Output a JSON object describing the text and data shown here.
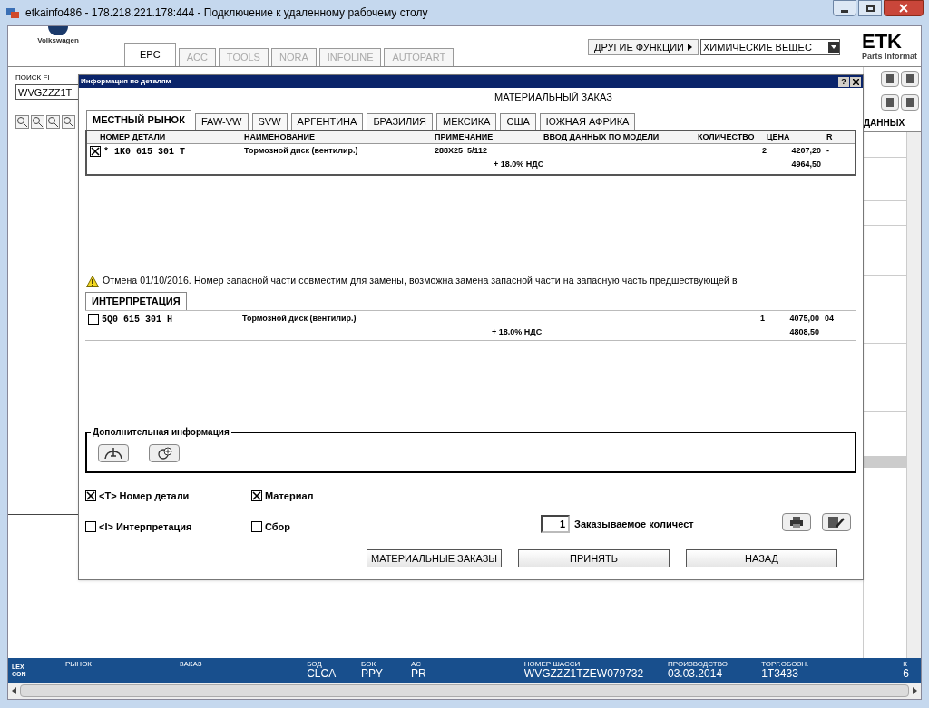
{
  "window": {
    "title": "etkainfo486 - 178.218.221.178:444 - Подключение к удаленному рабочему столу"
  },
  "app": {
    "brand": "Volkswagen",
    "tabs": [
      {
        "label": "EPC",
        "selected": true,
        "disabled": false
      },
      {
        "label": "ACC",
        "selected": false,
        "disabled": true
      },
      {
        "label": "TOOLS",
        "selected": false,
        "disabled": true
      },
      {
        "label": "NORA",
        "selected": false,
        "disabled": true
      },
      {
        "label": "INFOLINE",
        "selected": false,
        "disabled": true
      },
      {
        "label": "AUTOPART",
        "selected": false,
        "disabled": true
      }
    ],
    "other_functions": "ДРУГИЕ ФУНКЦИИ",
    "category_select": "ХИМИЧЕСКИЕ ВЕЩЕС",
    "logo": "ETK",
    "logo_subtitle": "Parts Informat",
    "search": {
      "label": "ПОИСК FI",
      "value": "WVGZZZ1T"
    },
    "data_tab": "ДАННЫХ"
  },
  "dialog": {
    "title": "Информация по деталям",
    "help": "?",
    "heading": "МАТЕРИАЛЬНЫЙ ЗАКАЗ",
    "market_tabs": [
      {
        "label": "МЕСТНЫЙ РЫНОК",
        "selected": true
      },
      {
        "label": "FAW-VW",
        "selected": false
      },
      {
        "label": "SVW",
        "selected": false
      },
      {
        "label": "АРГЕНТИНА",
        "selected": false
      },
      {
        "label": "БРАЗИЛИЯ",
        "selected": false
      },
      {
        "label": "МЕКСИКА",
        "selected": false
      },
      {
        "label": "США",
        "selected": false
      },
      {
        "label": "ЮЖНАЯ АФРИКА",
        "selected": false
      }
    ],
    "columns": [
      "НОМЕР ДЕТАЛИ",
      "НАИМЕНОВАНИЕ",
      "ПРИМЕЧАНИЕ",
      "ВВОД ДАННЫХ ПО МОДЕЛИ",
      "КОЛИЧЕСТВО",
      "ЦЕНА",
      "R"
    ],
    "parts": [
      {
        "checked": true,
        "number": "* 1K0 615 301 T",
        "name": "Тормозной диск (вентилир.)",
        "note": "288X25  5/112",
        "quantity": "2",
        "price": "4207,20",
        "r": "-",
        "vat": "+ 18.0% НДС",
        "price_with_vat": "4964,50"
      }
    ],
    "notice": "Отмена 01/10/2016. Номер запасной части совместим для замены, возможна замена запасной части на запасную часть предшествующей в",
    "interpretation_tab": {
      "label": "ИНТЕРПРЕТАЦИЯ",
      "selected": true
    },
    "interpretation_rows": [
      {
        "checked": false,
        "number": "5Q0 615 301 H",
        "name": "Тормозной диск (вентилир.)",
        "quantity": "1",
        "price": "4075,00",
        "r": "04",
        "vat": "+ 18.0% НДС",
        "price_with_vat": "4808,50"
      }
    ],
    "additional_info": "Дополнительная информация",
    "options": [
      {
        "label": "<T> Номер детали",
        "checked": true
      },
      {
        "label": "Материал",
        "checked": true
      },
      {
        "label": "<I> Интерпретация",
        "checked": false
      },
      {
        "label": "Сбор",
        "checked": false
      }
    ],
    "order_quantity": {
      "value": "1",
      "label": "Заказываемое количест"
    },
    "buttons": [
      "МАТЕРИАЛЬНЫЕ ЗАКАЗЫ",
      "ПРИНЯТЬ",
      "НАЗАД"
    ]
  },
  "status_bar": {
    "logo": [
      "LEX",
      "CON"
    ],
    "fields": [
      {
        "label": "РЫНОК"
      },
      {
        "label": "ЗАКАЗ"
      },
      {
        "label": "БОД",
        "value": "CLCA"
      },
      {
        "label": "БОК",
        "value": "PPY"
      },
      {
        "label": "АС",
        "value": "PR"
      },
      {
        "label": "НОМЕР ШАССИ",
        "value": "WVGZZZ1TZEW079732"
      },
      {
        "label": "ПРОИЗВОДСТВО",
        "value": "03.03.2014"
      },
      {
        "label": "ТОРГ.ОБОЗН.",
        "value": "1T3433"
      },
      {
        "label": "К",
        "value": "6"
      }
    ]
  }
}
